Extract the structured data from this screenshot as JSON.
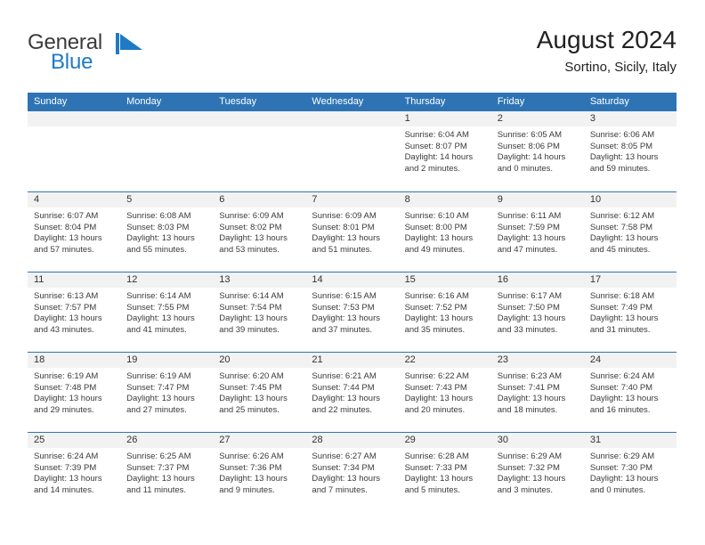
{
  "brand": {
    "word_one": "General",
    "word_two": "Blue",
    "mark_icon": "general-blue-flag-logo",
    "color_dark": "#3b3b3b",
    "color_blue": "#1f7ac4"
  },
  "header": {
    "title": "August 2024",
    "subtitle": "Sortino, Sicily, Italy"
  },
  "theme": {
    "header_blue": "#2e74b5",
    "daynum_gray": "#f2f2f2",
    "text": "#222222"
  },
  "calendar": {
    "weekday_headers": [
      "Sunday",
      "Monday",
      "Tuesday",
      "Wednesday",
      "Thursday",
      "Friday",
      "Saturday"
    ],
    "labels": {
      "sunrise": "Sunrise:",
      "sunset": "Sunset:",
      "daylight": "Daylight:"
    },
    "weeks": [
      [
        {
          "day": "",
          "empty": true
        },
        {
          "day": "",
          "empty": true
        },
        {
          "day": "",
          "empty": true
        },
        {
          "day": "",
          "empty": true
        },
        {
          "day": "1",
          "sunrise": "Sunrise: 6:04 AM",
          "sunset": "Sunset: 8:07 PM",
          "daylight": "Daylight: 14 hours and 2 minutes."
        },
        {
          "day": "2",
          "sunrise": "Sunrise: 6:05 AM",
          "sunset": "Sunset: 8:06 PM",
          "daylight": "Daylight: 14 hours and 0 minutes."
        },
        {
          "day": "3",
          "sunrise": "Sunrise: 6:06 AM",
          "sunset": "Sunset: 8:05 PM",
          "daylight": "Daylight: 13 hours and 59 minutes."
        }
      ],
      [
        {
          "day": "4",
          "sunrise": "Sunrise: 6:07 AM",
          "sunset": "Sunset: 8:04 PM",
          "daylight": "Daylight: 13 hours and 57 minutes."
        },
        {
          "day": "5",
          "sunrise": "Sunrise: 6:08 AM",
          "sunset": "Sunset: 8:03 PM",
          "daylight": "Daylight: 13 hours and 55 minutes."
        },
        {
          "day": "6",
          "sunrise": "Sunrise: 6:09 AM",
          "sunset": "Sunset: 8:02 PM",
          "daylight": "Daylight: 13 hours and 53 minutes."
        },
        {
          "day": "7",
          "sunrise": "Sunrise: 6:09 AM",
          "sunset": "Sunset: 8:01 PM",
          "daylight": "Daylight: 13 hours and 51 minutes."
        },
        {
          "day": "8",
          "sunrise": "Sunrise: 6:10 AM",
          "sunset": "Sunset: 8:00 PM",
          "daylight": "Daylight: 13 hours and 49 minutes."
        },
        {
          "day": "9",
          "sunrise": "Sunrise: 6:11 AM",
          "sunset": "Sunset: 7:59 PM",
          "daylight": "Daylight: 13 hours and 47 minutes."
        },
        {
          "day": "10",
          "sunrise": "Sunrise: 6:12 AM",
          "sunset": "Sunset: 7:58 PM",
          "daylight": "Daylight: 13 hours and 45 minutes."
        }
      ],
      [
        {
          "day": "11",
          "sunrise": "Sunrise: 6:13 AM",
          "sunset": "Sunset: 7:57 PM",
          "daylight": "Daylight: 13 hours and 43 minutes."
        },
        {
          "day": "12",
          "sunrise": "Sunrise: 6:14 AM",
          "sunset": "Sunset: 7:55 PM",
          "daylight": "Daylight: 13 hours and 41 minutes."
        },
        {
          "day": "13",
          "sunrise": "Sunrise: 6:14 AM",
          "sunset": "Sunset: 7:54 PM",
          "daylight": "Daylight: 13 hours and 39 minutes."
        },
        {
          "day": "14",
          "sunrise": "Sunrise: 6:15 AM",
          "sunset": "Sunset: 7:53 PM",
          "daylight": "Daylight: 13 hours and 37 minutes."
        },
        {
          "day": "15",
          "sunrise": "Sunrise: 6:16 AM",
          "sunset": "Sunset: 7:52 PM",
          "daylight": "Daylight: 13 hours and 35 minutes."
        },
        {
          "day": "16",
          "sunrise": "Sunrise: 6:17 AM",
          "sunset": "Sunset: 7:50 PM",
          "daylight": "Daylight: 13 hours and 33 minutes."
        },
        {
          "day": "17",
          "sunrise": "Sunrise: 6:18 AM",
          "sunset": "Sunset: 7:49 PM",
          "daylight": "Daylight: 13 hours and 31 minutes."
        }
      ],
      [
        {
          "day": "18",
          "sunrise": "Sunrise: 6:19 AM",
          "sunset": "Sunset: 7:48 PM",
          "daylight": "Daylight: 13 hours and 29 minutes."
        },
        {
          "day": "19",
          "sunrise": "Sunrise: 6:19 AM",
          "sunset": "Sunset: 7:47 PM",
          "daylight": "Daylight: 13 hours and 27 minutes."
        },
        {
          "day": "20",
          "sunrise": "Sunrise: 6:20 AM",
          "sunset": "Sunset: 7:45 PM",
          "daylight": "Daylight: 13 hours and 25 minutes."
        },
        {
          "day": "21",
          "sunrise": "Sunrise: 6:21 AM",
          "sunset": "Sunset: 7:44 PM",
          "daylight": "Daylight: 13 hours and 22 minutes."
        },
        {
          "day": "22",
          "sunrise": "Sunrise: 6:22 AM",
          "sunset": "Sunset: 7:43 PM",
          "daylight": "Daylight: 13 hours and 20 minutes."
        },
        {
          "day": "23",
          "sunrise": "Sunrise: 6:23 AM",
          "sunset": "Sunset: 7:41 PM",
          "daylight": "Daylight: 13 hours and 18 minutes."
        },
        {
          "day": "24",
          "sunrise": "Sunrise: 6:24 AM",
          "sunset": "Sunset: 7:40 PM",
          "daylight": "Daylight: 13 hours and 16 minutes."
        }
      ],
      [
        {
          "day": "25",
          "sunrise": "Sunrise: 6:24 AM",
          "sunset": "Sunset: 7:39 PM",
          "daylight": "Daylight: 13 hours and 14 minutes."
        },
        {
          "day": "26",
          "sunrise": "Sunrise: 6:25 AM",
          "sunset": "Sunset: 7:37 PM",
          "daylight": "Daylight: 13 hours and 11 minutes."
        },
        {
          "day": "27",
          "sunrise": "Sunrise: 6:26 AM",
          "sunset": "Sunset: 7:36 PM",
          "daylight": "Daylight: 13 hours and 9 minutes."
        },
        {
          "day": "28",
          "sunrise": "Sunrise: 6:27 AM",
          "sunset": "Sunset: 7:34 PM",
          "daylight": "Daylight: 13 hours and 7 minutes."
        },
        {
          "day": "29",
          "sunrise": "Sunrise: 6:28 AM",
          "sunset": "Sunset: 7:33 PM",
          "daylight": "Daylight: 13 hours and 5 minutes."
        },
        {
          "day": "30",
          "sunrise": "Sunrise: 6:29 AM",
          "sunset": "Sunset: 7:32 PM",
          "daylight": "Daylight: 13 hours and 3 minutes."
        },
        {
          "day": "31",
          "sunrise": "Sunrise: 6:29 AM",
          "sunset": "Sunset: 7:30 PM",
          "daylight": "Daylight: 13 hours and 0 minutes."
        }
      ]
    ]
  }
}
